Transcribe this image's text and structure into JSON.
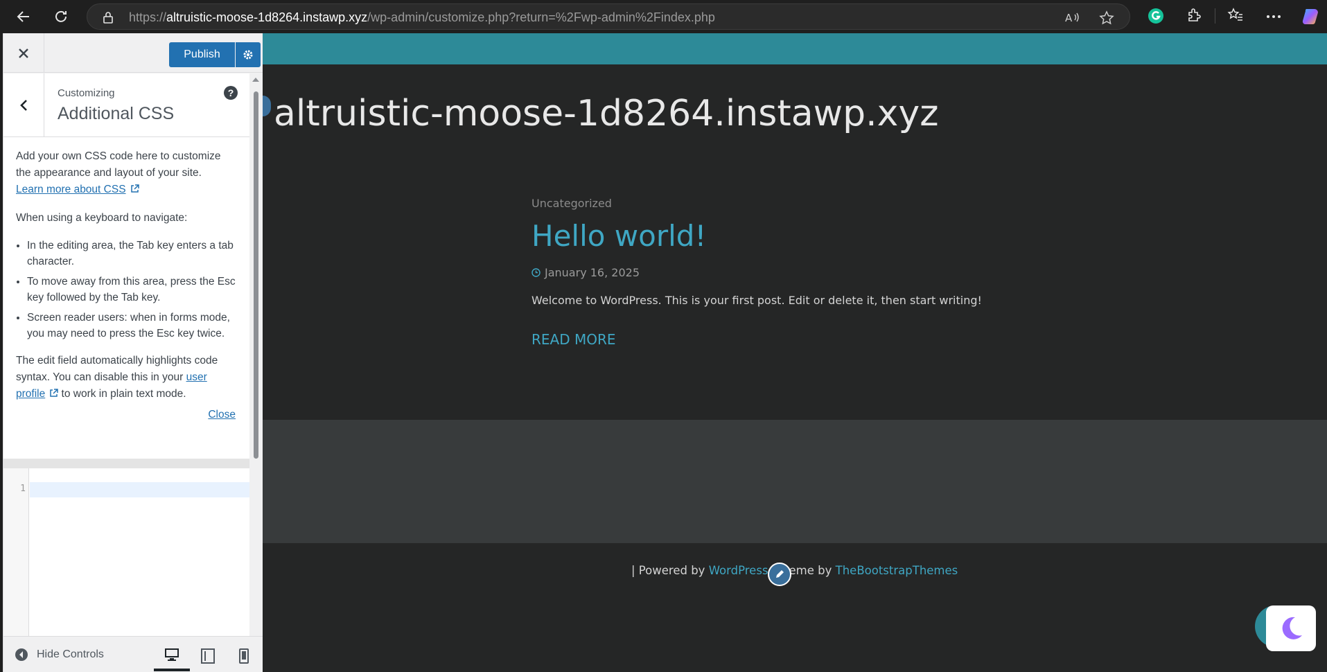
{
  "browser": {
    "url_scheme": "https://",
    "url_host": "altruistic-moose-1d8264.instawp.xyz",
    "url_path": "/wp-admin/customize.php?return=%2Fwp-admin%2Findex.php"
  },
  "customizer": {
    "publish_label": "Publish",
    "customizing_label": "Customizing",
    "section_title": "Additional CSS",
    "help_label": "?",
    "desc_intro": "Add your own CSS code here to customize the appearance and layout of your site.",
    "learn_more_link": "Learn more about CSS",
    "keyboard_intro": "When using a keyboard to navigate:",
    "keyboard_tips": [
      "In the editing area, the Tab key enters a tab character.",
      "To move away from this area, press the Esc key followed by the Tab key.",
      "Screen reader users: when in forms mode, you may need to press the Esc key twice."
    ],
    "highlight_text_a": "The edit field automatically highlights code syntax. You can disable this in your",
    "user_profile_link": "user profile",
    "highlight_text_b": "to work in plain text mode.",
    "close_link": "Close",
    "editor_line_number": "1",
    "editor_value": "",
    "hide_controls_label": "Hide Controls"
  },
  "preview": {
    "site_title": "altruistic-moose-1d8264.instawp.xyz",
    "post_category": "Uncategorized",
    "post_title": "Hello world!",
    "post_date": "January 16, 2025",
    "post_excerpt": "Welcome to WordPress. This is your first post. Edit or delete it, then start writing!",
    "read_more": "READ MORE",
    "footer_prefix": "| Powered by",
    "footer_wordpress": "WordPress",
    "footer_theme_text": "eme by",
    "footer_theme_link": "TheBootstrapThemes"
  },
  "colors": {
    "accent_blue": "#2271b1",
    "teal": "#2d8a98",
    "link_teal": "#3fa7c4"
  }
}
